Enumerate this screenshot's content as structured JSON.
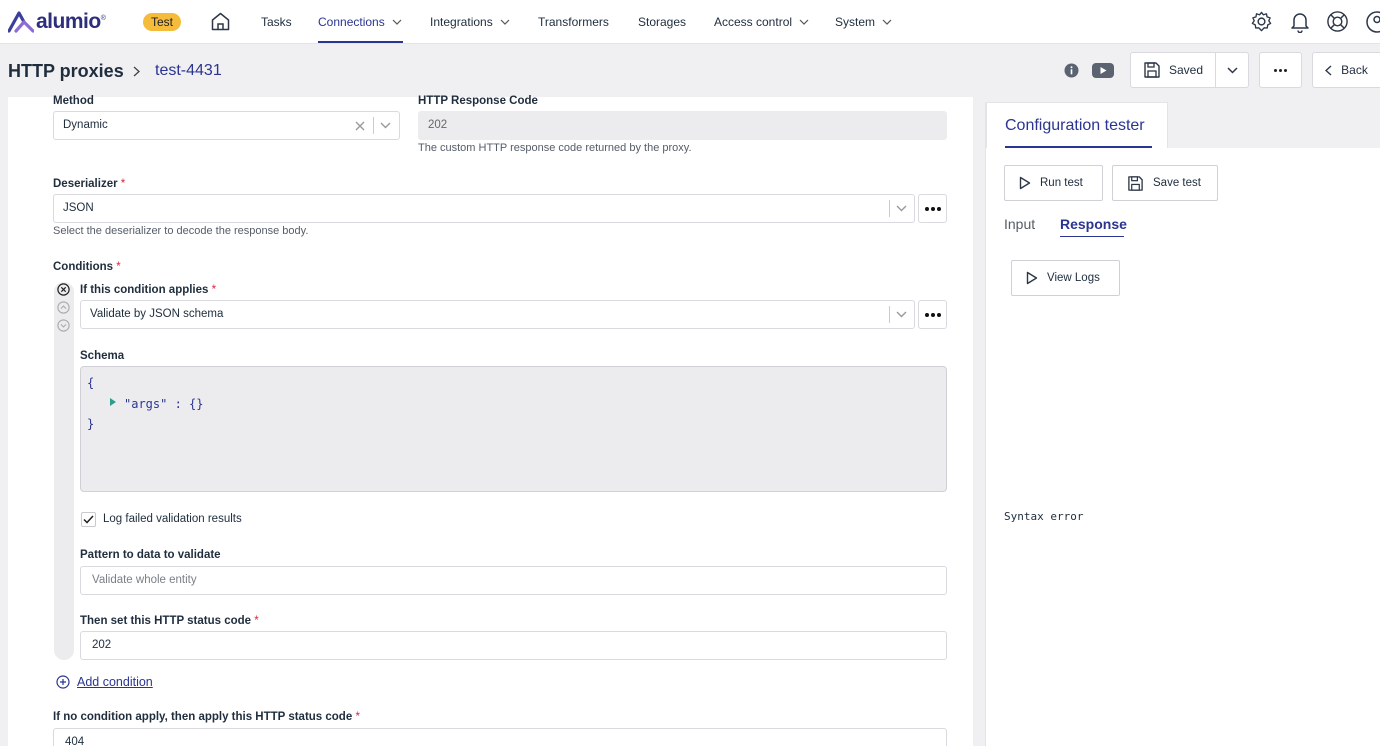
{
  "app": {
    "logo_text": "alumio",
    "environment_badge": "Test"
  },
  "nav": {
    "items": [
      {
        "label": "Tasks"
      },
      {
        "label": "Connections"
      },
      {
        "label": "Integrations"
      },
      {
        "label": "Transformers"
      },
      {
        "label": "Storages"
      },
      {
        "label": "Access control"
      },
      {
        "label": "System"
      }
    ],
    "active": "Connections"
  },
  "header": {
    "breadcrumb_root": "HTTP proxies",
    "breadcrumb_current": "test-4431",
    "saved_label": "Saved",
    "back_label": "Back"
  },
  "form": {
    "method": {
      "label": "Method",
      "value": "Dynamic"
    },
    "response_code": {
      "label": "HTTP Response Code",
      "value": "202",
      "help": "The custom HTTP response code returned by the proxy."
    },
    "deserializer": {
      "label": "Deserializer",
      "required_mark": "*",
      "value": "JSON",
      "help": "Select the deserializer to decode the response body."
    },
    "conditions": {
      "label": "Conditions",
      "required_mark": "*",
      "if_label": "If this condition applies",
      "condition_value": "Validate by JSON schema",
      "schema_label": "Schema",
      "schema_lines": [
        "{",
        "\"args\" : {}",
        "}"
      ],
      "log_failed_label": "Log failed validation results",
      "log_failed_checked": true,
      "pattern_label": "Pattern to data to validate",
      "pattern_placeholder": "Validate whole entity",
      "status_label": "Then set this HTTP status code",
      "status_value": "202",
      "add_condition": "Add condition"
    },
    "fallback": {
      "label": "If no condition apply, then apply this HTTP status code",
      "required_mark": "*",
      "value": "404"
    }
  },
  "tester": {
    "tab_label": "Configuration tester",
    "run_test": "Run test",
    "save_test": "Save test",
    "subtabs": {
      "input": "Input",
      "response": "Response",
      "active": "Response"
    },
    "view_logs": "View Logs",
    "output": "Syntax error"
  },
  "colors": {
    "brand": "#2b3590",
    "badge": "#f5bc3c",
    "required": "#d7263d"
  },
  "icons": [
    "home-icon",
    "settings-gear-icon",
    "bell-icon",
    "help-lifebuoy-icon",
    "user-icon",
    "info-icon",
    "youtube-icon",
    "save-disk-icon",
    "play-icon",
    "chevron-down-icon",
    "chevron-right-icon",
    "chevron-left-icon",
    "clear-x-icon",
    "plus-circle-icon",
    "check-icon"
  ]
}
